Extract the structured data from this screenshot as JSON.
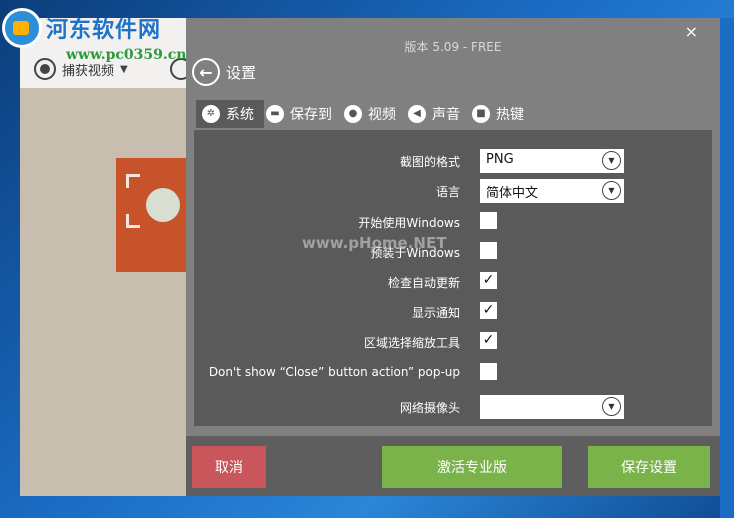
{
  "watermark": {
    "site_name": "河东软件网",
    "site_url": "www.pc0359.cn",
    "overlay_text": "www.pHome.NET"
  },
  "background_app": {
    "capture_label": "捕获视频"
  },
  "dialog": {
    "version": "版本 5.09 - FREE",
    "close_glyph": "×",
    "back_label": "设置",
    "tabs": [
      {
        "label": "系统",
        "icon": "gear-icon",
        "active": true
      },
      {
        "label": "保存到",
        "icon": "folder-icon",
        "active": false
      },
      {
        "label": "视频",
        "icon": "record-icon",
        "active": false
      },
      {
        "label": "声音",
        "icon": "speaker-icon",
        "active": false
      },
      {
        "label": "热键",
        "icon": "keyboard-icon",
        "active": false
      }
    ],
    "settings": {
      "format": {
        "label": "截图的格式",
        "value": "PNG"
      },
      "language": {
        "label": "语言",
        "value": "简体中文"
      },
      "start_with_windows": {
        "label": "开始使用Windows",
        "checked": false
      },
      "preload_windows": {
        "label": "预装于Windows",
        "checked": false
      },
      "check_updates": {
        "label": "检查自动更新",
        "checked": true
      },
      "show_notifications": {
        "label": "显示通知",
        "checked": true
      },
      "zoom_tool": {
        "label": "区域选择缩放工具",
        "checked": true
      },
      "close_popup": {
        "label": "Don't show “Close” button action” pop-up",
        "checked": false
      },
      "webcam": {
        "label": "网络摄像头",
        "value": ""
      }
    },
    "buttons": {
      "cancel": "取消",
      "activate": "激活专业版",
      "save": "保存设置"
    }
  },
  "colors": {
    "dialog_bg": "#808080",
    "panel_bg": "#5a5a5a",
    "cancel": "#c9565a",
    "accent_green": "#7ab34a"
  }
}
